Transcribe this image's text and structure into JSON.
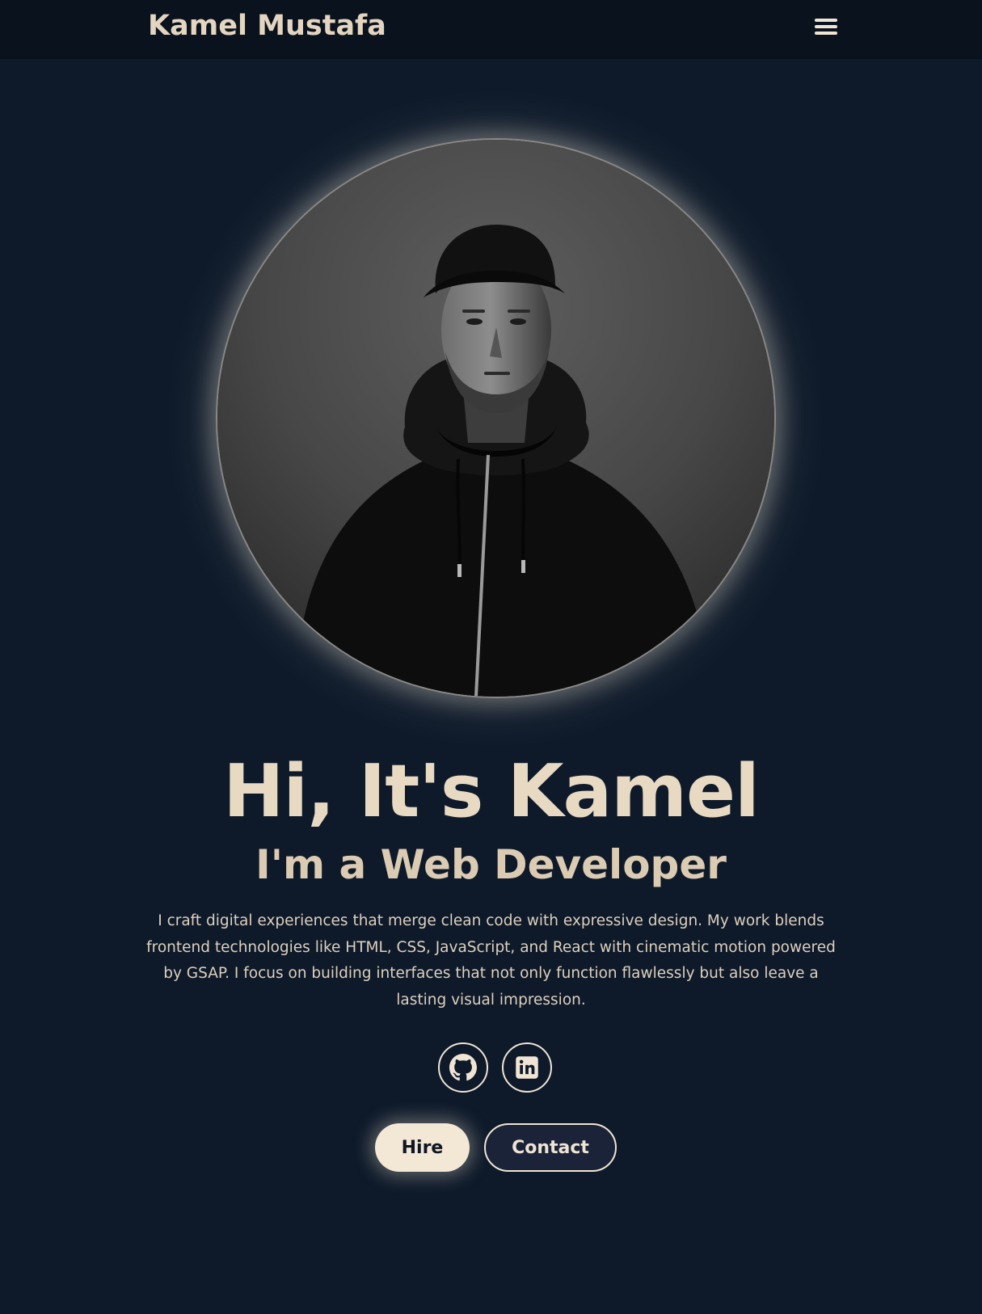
{
  "header": {
    "brand": "Kamel Mustafa",
    "menu_icon": "hamburger-menu-icon"
  },
  "hero": {
    "portrait_alt": "Portrait photo",
    "title": "Hi, It's Kamel",
    "subtitle": "I'm a Web Developer",
    "description": "I craft digital experiences that merge clean code with expressive design. My work blends frontend technologies like HTML, CSS, JavaScript, and React with cinematic motion powered by GSAP. I focus on building interfaces that not only function flawlessly but also leave a lasting visual impression."
  },
  "social": [
    {
      "icon": "github-icon"
    },
    {
      "icon": "linkedin-icon"
    }
  ],
  "actions": {
    "hire_label": "Hire",
    "contact_label": "Contact"
  },
  "colors": {
    "background": "#0e1a2a",
    "header_background": "#09121d",
    "accent": "#f3e7d5",
    "contact_button_bg": "#1a2338"
  }
}
